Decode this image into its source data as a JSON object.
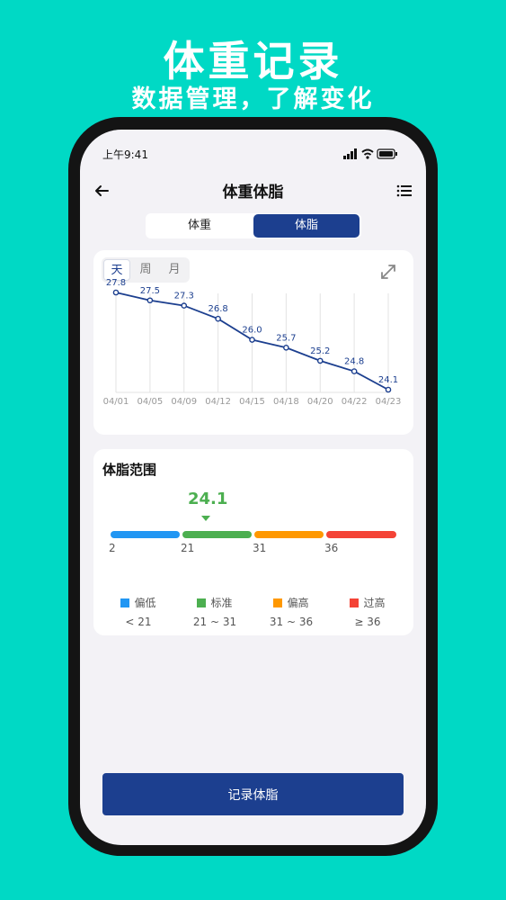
{
  "promo": {
    "title": "体重记录",
    "subtitle": "数据管理，了解变化"
  },
  "status_bar": {
    "time": "上午9:41"
  },
  "nav": {
    "title": "体重体脂",
    "back_icon": "back-arrow-icon",
    "menu_icon": "list-icon"
  },
  "segment": {
    "items": [
      "体重",
      "体脂"
    ],
    "selected": "体脂"
  },
  "period_tabs": {
    "items": [
      "天",
      "周",
      "月"
    ],
    "selected": "天"
  },
  "colors": {
    "primary": "#1c3f8f",
    "low": "#2196f3",
    "normal": "#4caf50",
    "high": "#ff9800",
    "over": "#f44336",
    "background": "#00d9c5"
  },
  "chart_data": {
    "type": "line",
    "categories": [
      "04/01",
      "04/05",
      "04/09",
      "04/12",
      "04/15",
      "04/18",
      "04/20",
      "04/22",
      "04/23"
    ],
    "values": [
      27.8,
      27.5,
      27.3,
      26.8,
      26.0,
      25.7,
      25.2,
      24.8,
      24.1
    ],
    "value_labels": [
      "27.8",
      "27.5",
      "27.3",
      "26.8",
      "26.0",
      "25.7",
      "25.2",
      "24.8",
      "24.1"
    ],
    "title": "",
    "xlabel": "",
    "ylabel": "",
    "grid": "vertical"
  },
  "range": {
    "title": "体脂范围",
    "current_value": "24.1",
    "ticks": [
      "2",
      "21",
      "31",
      "36"
    ],
    "legend": [
      {
        "label": "偏低",
        "range": "< 21",
        "color": "#2196f3"
      },
      {
        "label": "标准",
        "range": "21 ~ 31",
        "color": "#4caf50"
      },
      {
        "label": "偏高",
        "range": "31 ~ 36",
        "color": "#ff9800"
      },
      {
        "label": "过高",
        "range": "≥ 36",
        "color": "#f44336"
      }
    ]
  },
  "action": {
    "record_label": "记录体脂"
  }
}
